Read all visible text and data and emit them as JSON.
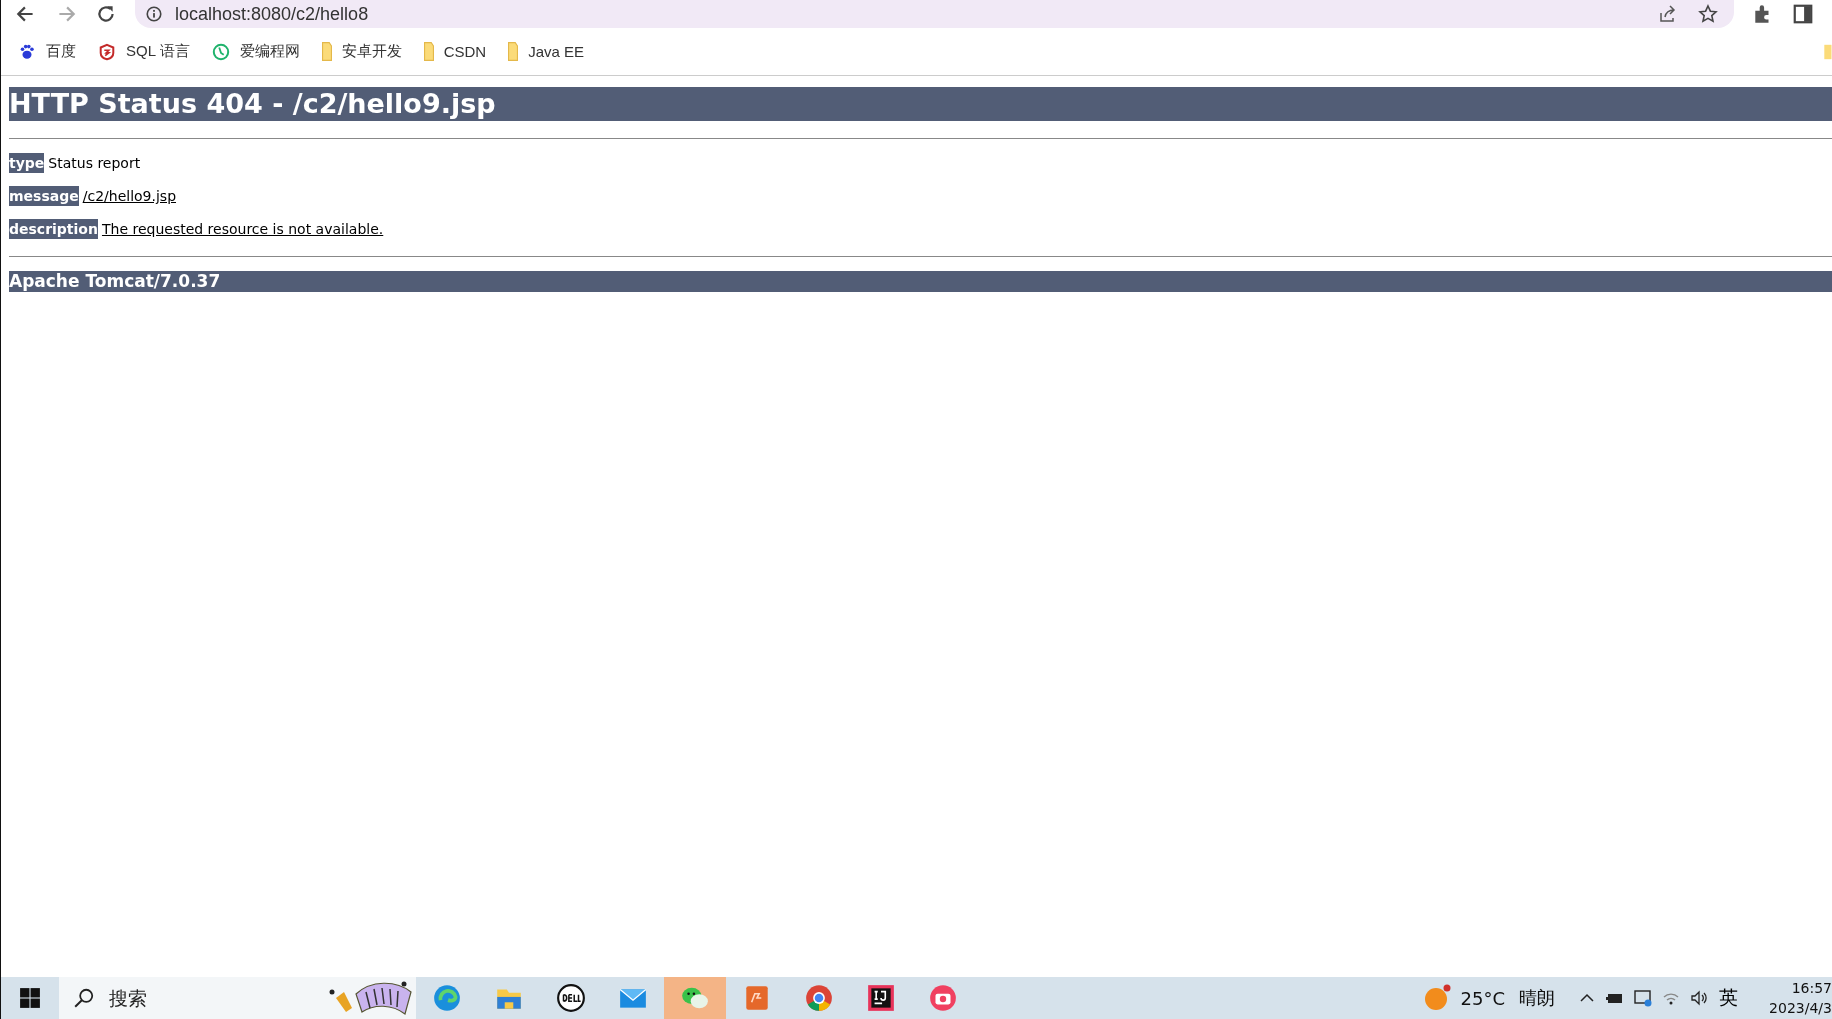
{
  "browser": {
    "address": "localhost:8080/c2/hello8",
    "bookmarks": [
      {
        "label": "百度",
        "kind": "paw"
      },
      {
        "label": "SQL 语言",
        "kind": "shield"
      },
      {
        "label": "爱编程网",
        "kind": "clock"
      },
      {
        "label": "安卓开发",
        "kind": "folder"
      },
      {
        "label": "CSDN",
        "kind": "folder"
      },
      {
        "label": "Java EE",
        "kind": "folder"
      }
    ]
  },
  "page": {
    "heading": "HTTP Status 404 - /c2/hello9.jsp",
    "fields": [
      {
        "label": "type",
        "value": "Status report",
        "underlined": false
      },
      {
        "label": "message",
        "value": "/c2/hello9.jsp",
        "underlined": true
      },
      {
        "label": "description",
        "value": "The requested resource is not available.",
        "underlined": true
      }
    ],
    "footer": "Apache Tomcat/7.0.37"
  },
  "taskbar": {
    "search": {
      "placeholder": "搜索"
    },
    "apps": [
      {
        "kind": "edge",
        "active": false
      },
      {
        "kind": "files",
        "active": false
      },
      {
        "kind": "dell",
        "active": false
      },
      {
        "kind": "mail",
        "active": false
      },
      {
        "kind": "chat",
        "active": true
      },
      {
        "kind": "pdf",
        "active": false
      },
      {
        "kind": "chrome",
        "active": false
      },
      {
        "kind": "ide",
        "active": false
      },
      {
        "kind": "camera",
        "active": false
      }
    ],
    "weather": {
      "temperature": "25°C",
      "condition": "晴朗"
    },
    "ime": "英",
    "time": "16:57",
    "date": "2023/4/3"
  }
}
